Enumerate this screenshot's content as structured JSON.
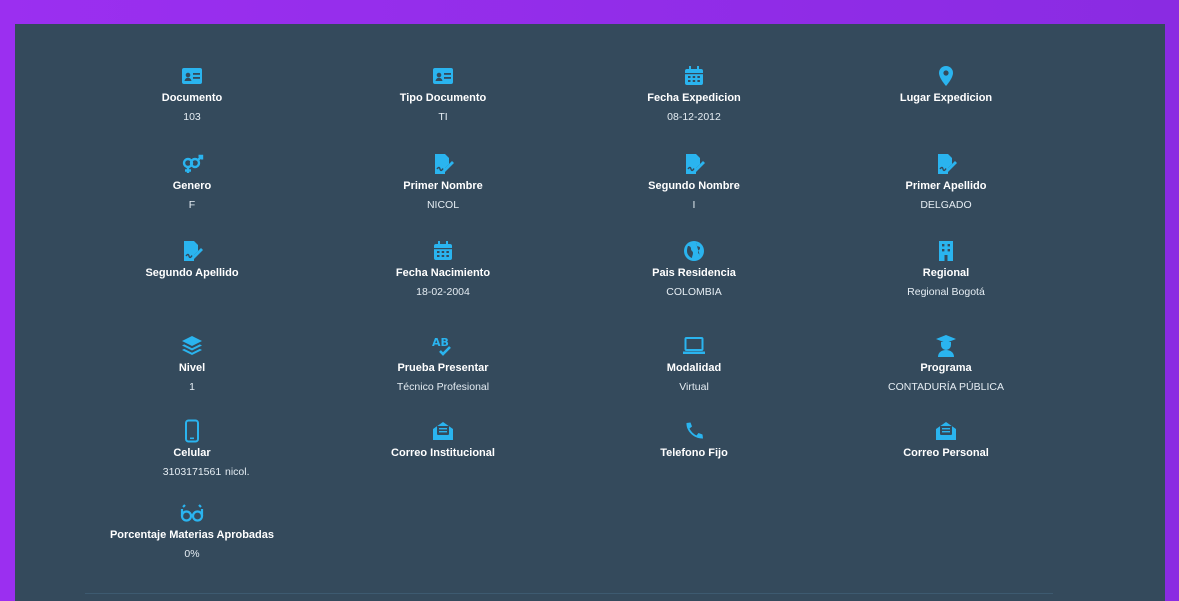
{
  "colors": {
    "accent": "#2ab4ef",
    "panel": "#344a5c",
    "frame": "#8e2de2"
  },
  "fields": [
    {
      "id": "documento",
      "label": "Documento",
      "value": "103",
      "icon": "id-card-icon"
    },
    {
      "id": "tipo-documento",
      "label": "Tipo Documento",
      "value": "TI",
      "icon": "id-card-icon"
    },
    {
      "id": "fecha-expedicion",
      "label": "Fecha Expedicion",
      "value": "08-12-2012",
      "icon": "calendar-icon"
    },
    {
      "id": "lugar-expedicion",
      "label": "Lugar Expedicion",
      "value": "",
      "icon": "map-pin-icon"
    },
    {
      "id": "genero",
      "label": "Genero",
      "value": "F",
      "icon": "gender-icon"
    },
    {
      "id": "primer-nombre",
      "label": "Primer Nombre",
      "value": "NICOL",
      "icon": "signature-icon"
    },
    {
      "id": "segundo-nombre",
      "label": "Segundo Nombre",
      "value": "I",
      "icon": "signature-icon"
    },
    {
      "id": "primer-apellido",
      "label": "Primer Apellido",
      "value": "DELGADO",
      "icon": "signature-icon"
    },
    {
      "id": "segundo-apellido",
      "label": "Segundo Apellido",
      "value": "",
      "icon": "signature-icon"
    },
    {
      "id": "fecha-nacimiento",
      "label": "Fecha Nacimiento",
      "value": "18-02-2004",
      "icon": "calendar-icon"
    },
    {
      "id": "pais-residencia",
      "label": "Pais Residencia",
      "value": "COLOMBIA",
      "icon": "globe-icon"
    },
    {
      "id": "regional",
      "label": "Regional",
      "value": "Regional Bogotá",
      "icon": "building-icon"
    },
    {
      "id": "nivel",
      "label": "Nivel",
      "value": "1",
      "icon": "layers-icon"
    },
    {
      "id": "prueba-presentar",
      "label": "Prueba Presentar",
      "value": "Técnico Profesional",
      "icon": "spellcheck-icon"
    },
    {
      "id": "modalidad",
      "label": "Modalidad",
      "value": "Virtual",
      "icon": "laptop-icon"
    },
    {
      "id": "programa",
      "label": "Programa",
      "value": "CONTADURÍA PÚBLICA",
      "icon": "graduate-icon"
    },
    {
      "id": "celular",
      "label": "Celular",
      "value": "3103171561",
      "icon": "mobile-icon"
    },
    {
      "id": "correo-institucional",
      "label": "Correo Institucional",
      "value": "nicol.",
      "icon": "envelope-open-icon"
    },
    {
      "id": "telefono-fijo",
      "label": "Telefono Fijo",
      "value": "",
      "icon": "phone-icon"
    },
    {
      "id": "correo-personal",
      "label": "Correo Personal",
      "value": "",
      "icon": "envelope-open-icon"
    },
    {
      "id": "porcentaje",
      "label": "Porcentaje Materias Aprobadas",
      "value": "0%",
      "icon": "glasses-icon"
    }
  ]
}
